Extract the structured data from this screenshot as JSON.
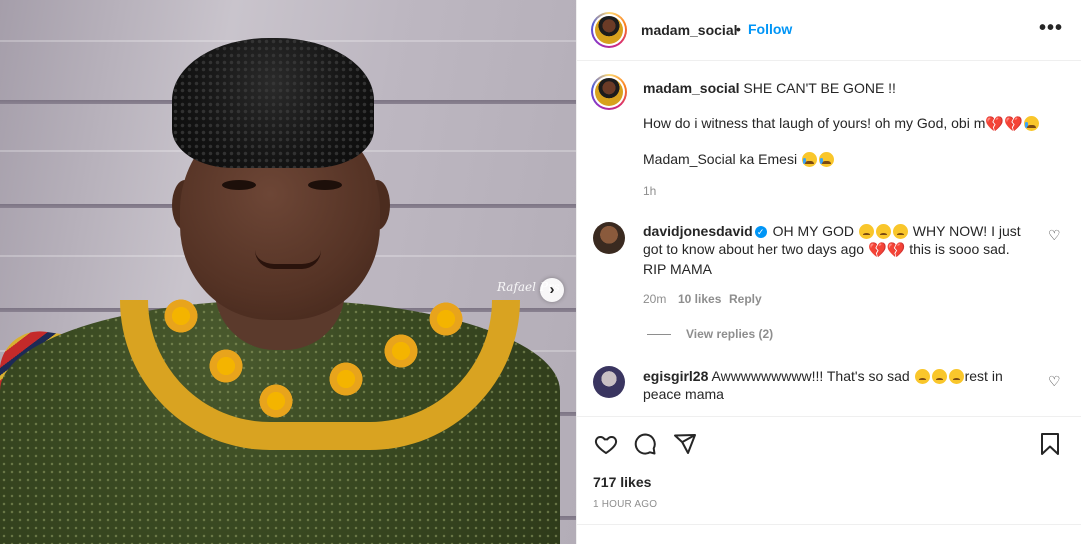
{
  "post": {
    "image_alt": "Portrait of an elderly woman in a black headwrap and green dress with yellow flower collar",
    "watermark": "Rafael Prs",
    "next_icon": "chevron-right-icon"
  },
  "header": {
    "username": "madam_social",
    "separator": "•",
    "follow_label": "Follow",
    "more_icon": "more-horizontal-icon",
    "more_label": "•••"
  },
  "caption": {
    "username": "madam_social",
    "line1": "SHE CAN'T BE GONE !!",
    "line2": "How do i witness that laugh of yours! oh my God, obi m",
    "line3": "Madam_Social ka Emesi",
    "time": "1h"
  },
  "comments": [
    {
      "username": "davidjonesdavid",
      "verified": true,
      "text_a": "OH MY GOD",
      "text_b": "WHY NOW! I just",
      "text_c": "got to know about her two days ago",
      "text_d": "this is sooo sad.",
      "text_e": "RIP MAMA",
      "time": "20m",
      "likes": "10 likes",
      "reply_label": "Reply",
      "view_replies": "View replies (2)"
    },
    {
      "username": "egisgirl28",
      "verified": false,
      "text_a": "Awwwwwwwww!!! That's so sad",
      "text_b": "rest in peace",
      "text_c": "mama"
    }
  ],
  "actions": {
    "like_icon": "heart-icon",
    "comment_icon": "comment-icon",
    "share_icon": "send-icon",
    "save_icon": "bookmark-icon",
    "likes_count": "717 likes",
    "posted_ago": "1 HOUR AGO"
  },
  "colors": {
    "accent": "#0095f6",
    "text": "#262626",
    "muted": "#8e8e8e",
    "border": "#efefef",
    "heart": "#d0021b"
  }
}
